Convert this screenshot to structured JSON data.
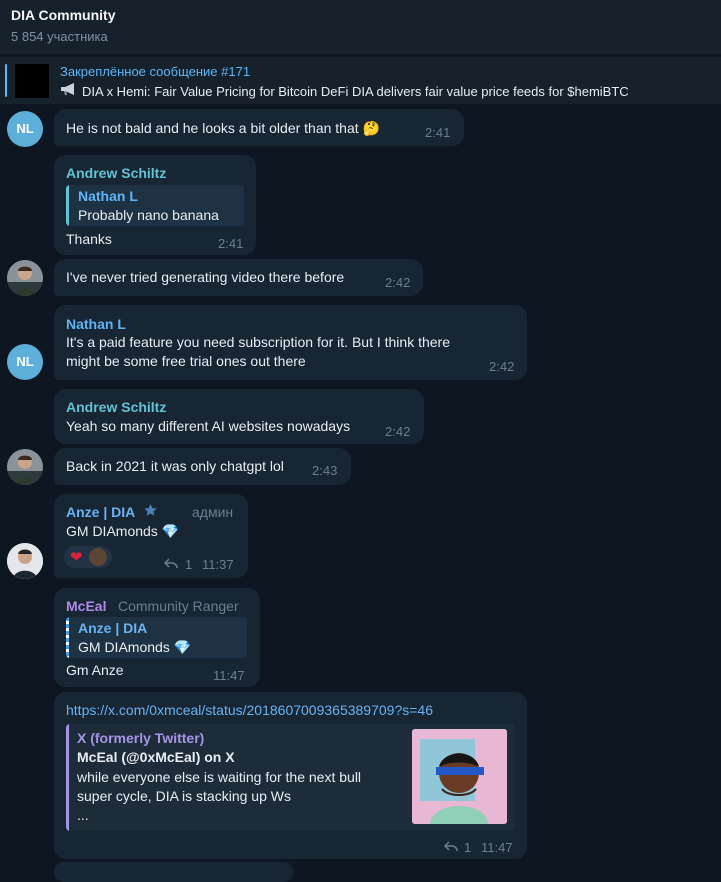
{
  "header": {
    "title": "DIA Community",
    "subtitle": "5 854 участника"
  },
  "pinned": {
    "title": "Закреплённое сообщение #171",
    "icon": "megaphone-icon",
    "text": "DIA x Hemi: Fair Value Pricing for Bitcoin DeFi  DIA delivers fair value price feeds for $hemiBTC"
  },
  "messages": [
    {
      "text": "He is not bald and he looks a bit older than that",
      "emoji": "🤔",
      "time": "2:41"
    },
    {
      "sender": "Andrew Schiltz",
      "reply": {
        "sender": "Nathan L",
        "text": "Probably nano banana"
      },
      "text": "Thanks",
      "time": "2:41"
    },
    {
      "text": "I've never tried generating video there before",
      "time": "2:42"
    },
    {
      "sender": "Nathan L",
      "lines": [
        "It's a paid feature you need subscription for it. But I think there",
        "might be some free trial ones out there"
      ],
      "time": "2:42",
      "avatar_initials": "NL"
    },
    {
      "sender": "Andrew Schiltz",
      "text": "Yeah so many different AI websites nowadays",
      "time": "2:42"
    },
    {
      "text": "Back in 2021 it was only chatgpt lol",
      "time": "2:43"
    },
    {
      "sender": "Anze | DIA",
      "sender_badge": "star-icon",
      "role": "админ",
      "text": "GM DIAmonds",
      "emoji": "💎",
      "reaction": "❤",
      "replies": "1",
      "time": "11:37"
    },
    {
      "sender": "McEal",
      "rank": "Community Ranger",
      "reply": {
        "sender": "Anze | DIA",
        "text": "GM DIAmonds",
        "emoji": "💎"
      },
      "text": "Gm Anze",
      "time": "11:47"
    },
    {
      "link": "https://x.com/0xmceal/status/2018607009365389709?s=46",
      "preview": {
        "site": "X (formerly Twitter)",
        "title": "McEal (@0xMcEal) on X",
        "desc_lines": [
          "while everyone else is waiting for the next bull",
          "super cycle, DIA is stacking up Ws",
          "..."
        ]
      },
      "replies": "1",
      "time": "11:47"
    }
  ],
  "avatars": {
    "nl_initials": "NL"
  },
  "colors": {
    "accent": "#5eb5f7",
    "bubble": "#182533",
    "background": "#0e1621",
    "andrew": "#61c3d4",
    "anze": "#6ab3f3",
    "mceal": "#b08ae6"
  }
}
